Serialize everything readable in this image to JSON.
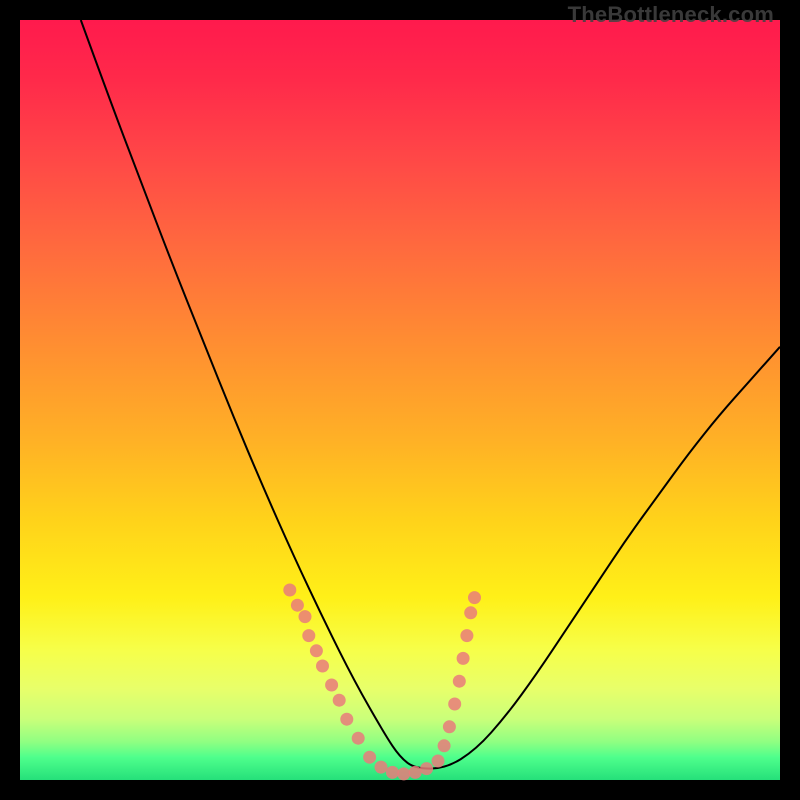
{
  "watermark": "TheBottleneck.com",
  "colors": {
    "marker": "#e97b7b",
    "curve": "#000000",
    "gradient_top": "#ff1a4d",
    "gradient_mid": "#ffd31a",
    "gradient_bottom": "#25e07a",
    "frame": "#000000"
  },
  "chart_data": {
    "type": "line",
    "title": "",
    "xlabel": "",
    "ylabel": "",
    "xlim": [
      0,
      100
    ],
    "ylim": [
      0,
      100
    ],
    "grid": false,
    "legend": false,
    "notes": "V-shaped bottleneck curve; y ≈ bottleneck %, minimum (≈0%) around x ≈ 45–55. Left branch starts ~100% at x≈8, right branch rises to ~57% at x=100. Scatter markers cluster near the valley (x 35–60, y 0–25).",
    "series": [
      {
        "name": "curve",
        "x": [
          8,
          12,
          16,
          20,
          24,
          28,
          32,
          36,
          40,
          44,
          48,
          50,
          52,
          56,
          60,
          64,
          68,
          72,
          76,
          80,
          84,
          88,
          92,
          96,
          100
        ],
        "y": [
          100,
          89,
          78.5,
          68,
          58,
          48,
          38.5,
          29.5,
          21,
          13,
          6,
          3,
          1.5,
          1.5,
          4,
          8.5,
          14,
          20,
          26,
          32,
          37.5,
          43,
          48,
          52.5,
          57
        ]
      }
    ],
    "scatter": [
      {
        "x": 35.5,
        "y": 25
      },
      {
        "x": 36.5,
        "y": 23
      },
      {
        "x": 37.5,
        "y": 21.5
      },
      {
        "x": 38.0,
        "y": 19
      },
      {
        "x": 39.0,
        "y": 17
      },
      {
        "x": 39.8,
        "y": 15
      },
      {
        "x": 41.0,
        "y": 12.5
      },
      {
        "x": 42.0,
        "y": 10.5
      },
      {
        "x": 43.0,
        "y": 8
      },
      {
        "x": 44.5,
        "y": 5.5
      },
      {
        "x": 46.0,
        "y": 3
      },
      {
        "x": 47.5,
        "y": 1.7
      },
      {
        "x": 49.0,
        "y": 1.0
      },
      {
        "x": 50.5,
        "y": 0.8
      },
      {
        "x": 52.0,
        "y": 1.0
      },
      {
        "x": 53.5,
        "y": 1.5
      },
      {
        "x": 55.0,
        "y": 2.5
      },
      {
        "x": 55.8,
        "y": 4.5
      },
      {
        "x": 56.5,
        "y": 7.0
      },
      {
        "x": 57.2,
        "y": 10.0
      },
      {
        "x": 57.8,
        "y": 13.0
      },
      {
        "x": 58.3,
        "y": 16.0
      },
      {
        "x": 58.8,
        "y": 19.0
      },
      {
        "x": 59.3,
        "y": 22.0
      },
      {
        "x": 59.8,
        "y": 24.0
      }
    ]
  }
}
